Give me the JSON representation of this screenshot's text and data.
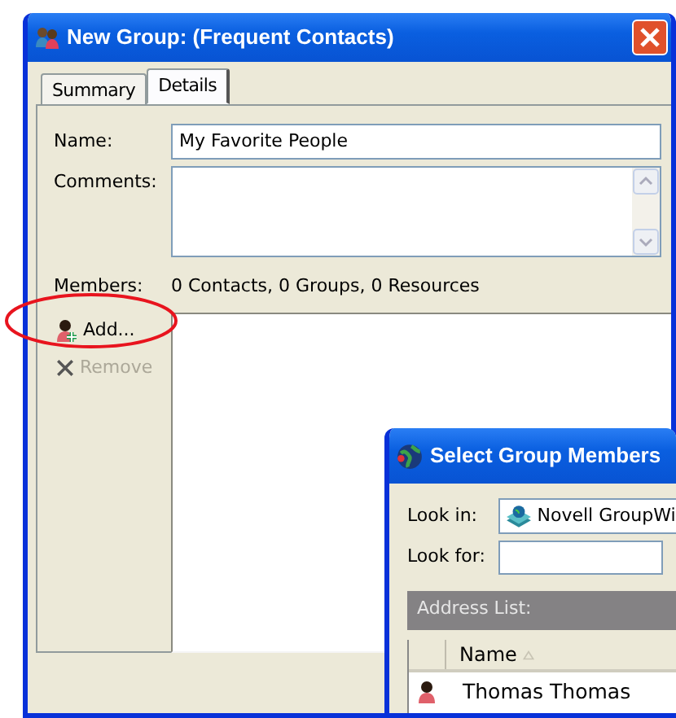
{
  "main_window": {
    "title": "New Group:  (Frequent Contacts)",
    "tabs": [
      {
        "label": "Summary",
        "selected": false
      },
      {
        "label": "Details",
        "selected": true
      }
    ],
    "name_label": "Name:",
    "name_value": "My Favorite People",
    "comments_label": "Comments:",
    "members_label": "Members:",
    "members_summary": "0 Contacts, 0 Groups, 0 Resources",
    "buttons": [
      {
        "kind": "add",
        "label": "Add...",
        "disabled": false,
        "highlighted": true
      },
      {
        "kind": "remove",
        "label": "Remove",
        "disabled": true,
        "highlighted": false
      }
    ]
  },
  "dialog": {
    "title": "Select Group Members",
    "look_in_label": "Look in:",
    "look_in_value": "Novell GroupWi",
    "look_for_label": "Look for:",
    "address_list_label": "Address List:",
    "columns": [
      "Name"
    ],
    "rows": [
      {
        "name": "Thomas Thomas"
      }
    ]
  }
}
